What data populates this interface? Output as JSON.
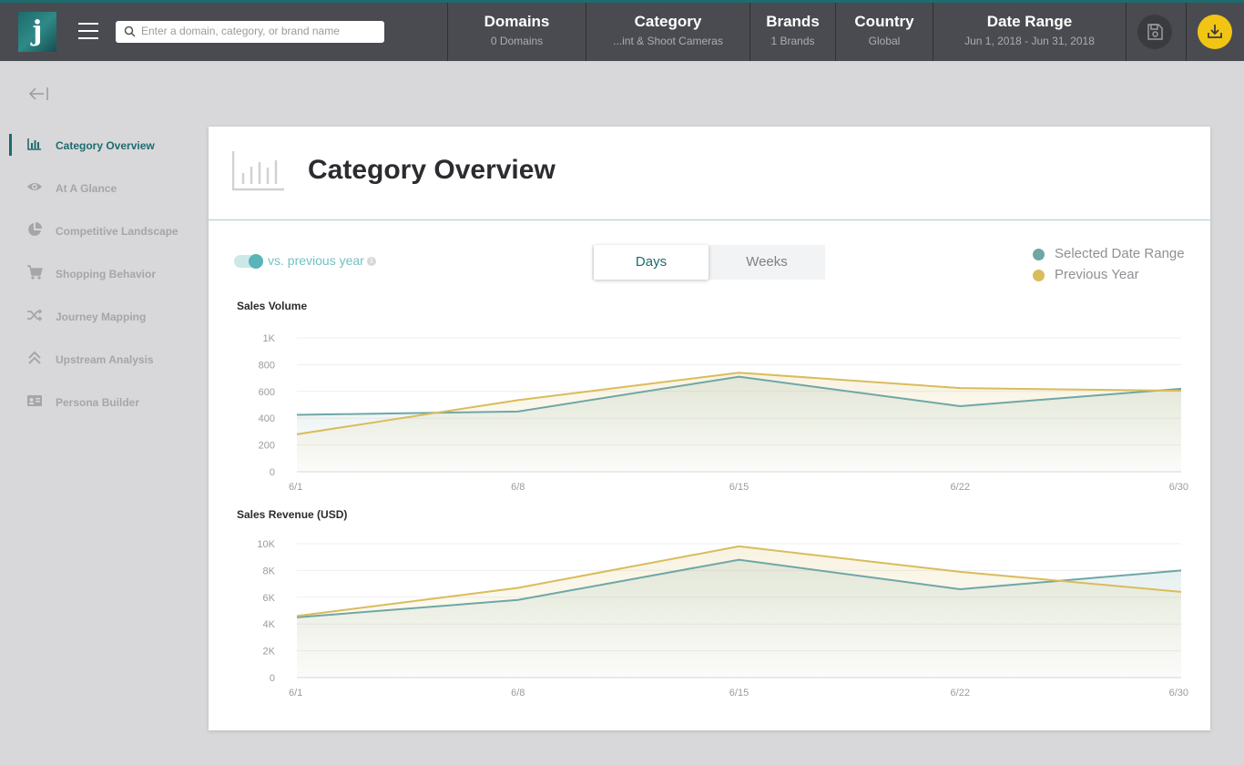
{
  "app": {
    "logo_letter": "j",
    "search": {
      "placeholder": "Enter a domain, category, or brand name",
      "value": ""
    }
  },
  "filters": [
    {
      "title": "Domains",
      "value": "0 Domains"
    },
    {
      "title": "Category",
      "value": "...int & Shoot Cameras"
    },
    {
      "title": "Brands",
      "value": "1 Brands"
    },
    {
      "title": "Country",
      "value": "Global"
    },
    {
      "title": "Date Range",
      "value": "Jun 1, 2018 - Jun 31, 2018"
    }
  ],
  "header_icons": {
    "save": "save-icon",
    "download": "download-icon"
  },
  "sidebar": {
    "collapse_icon": "collapse-left-icon",
    "items": [
      {
        "label": "Category Overview",
        "icon": "bar-chart-icon",
        "active": true
      },
      {
        "label": "At A Glance",
        "icon": "eye-icon",
        "active": false
      },
      {
        "label": "Competitive Landscape",
        "icon": "pie-chart-icon",
        "active": false
      },
      {
        "label": "Shopping Behavior",
        "icon": "cart-icon",
        "active": false
      },
      {
        "label": "Journey Mapping",
        "icon": "shuffle-icon",
        "active": false
      },
      {
        "label": "Upstream Analysis",
        "icon": "double-chevron-up-icon",
        "active": false
      },
      {
        "label": "Persona Builder",
        "icon": "id-card-icon",
        "active": false
      }
    ]
  },
  "page": {
    "title": "Category Overview",
    "toggle": {
      "label": "vs. previous year",
      "on": true
    },
    "granularity": {
      "options": [
        "Days",
        "Weeks"
      ],
      "selected": "Days"
    },
    "legend": [
      {
        "label": "Selected Date Range",
        "color": "#6ea7a6"
      },
      {
        "label": "Previous Year",
        "color": "#d9bc5c"
      }
    ]
  },
  "colors": {
    "selected": "#6ea7a6",
    "previous": "#d9bc5c",
    "accent": "#1e6b6e",
    "download_bg": "#f2c515"
  },
  "chart_data": [
    {
      "type": "area",
      "title": "Sales Volume",
      "x": [
        "6/1",
        "6/8",
        "6/15",
        "6/22",
        "6/30"
      ],
      "ylim": [
        0,
        1000
      ],
      "yticks": [
        "0",
        "200",
        "400",
        "600",
        "800",
        "1K"
      ],
      "ytick_values": [
        0,
        200,
        400,
        600,
        800,
        1000
      ],
      "grid": true,
      "series": [
        {
          "name": "Selected Date Range",
          "values": [
            425,
            450,
            710,
            490,
            620
          ]
        },
        {
          "name": "Previous Year",
          "values": [
            280,
            535,
            740,
            625,
            605
          ]
        }
      ]
    },
    {
      "type": "area",
      "title": "Sales Revenue (USD)",
      "x": [
        "6/1",
        "6/8",
        "6/15",
        "6/22",
        "6/30"
      ],
      "ylim": [
        0,
        10000
      ],
      "yticks": [
        "0",
        "2K",
        "4K",
        "6K",
        "8K",
        "10K"
      ],
      "ytick_values": [
        0,
        2000,
        4000,
        6000,
        8000,
        10000
      ],
      "grid": true,
      "series": [
        {
          "name": "Selected Date Range",
          "values": [
            4500,
            5800,
            8800,
            6600,
            8000
          ]
        },
        {
          "name": "Previous Year",
          "values": [
            4600,
            6700,
            9800,
            7900,
            6400
          ]
        }
      ]
    }
  ]
}
